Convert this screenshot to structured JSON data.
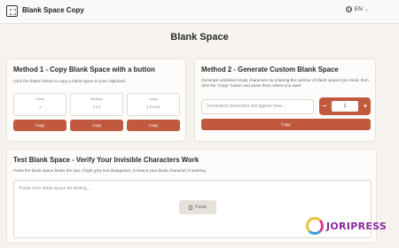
{
  "header": {
    "brand": "Blank Space Copy",
    "lang": "EN"
  },
  "page_title": "Blank Space",
  "method1": {
    "title": "Method 1 - Copy Blank Space with a button",
    "desc": "Click the button below to copy a blank space to your clipboard.",
    "options": [
      {
        "label": "Small",
        "chars": "1"
      },
      {
        "label": "Medium",
        "chars": "1 2 3"
      },
      {
        "label": "Large",
        "chars": "1 2 3 4 5"
      }
    ],
    "copy_label": "Copy"
  },
  "method2": {
    "title": "Method 2 - Generate Custom Blank Space",
    "desc": "Generate unlimited empty characters by entering the number of blank spaces you need, then click the \"Copy\" button and paste them where you want",
    "input_placeholder": "Generated characters will appear here...",
    "minus": "−",
    "plus": "+",
    "count": "1",
    "copy_label": "Copy"
  },
  "test": {
    "title": "Test Blank Space - Verify Your Invisible Characters Work",
    "desc": "Paste the blank space below the text. If light grey text disappears, it means your blank character is working.",
    "placeholder": "Paste here blank space for testing....",
    "paste_label": "Paste"
  },
  "watermark": {
    "text": "JORIPRESS"
  },
  "colors": {
    "accent": "#c1593e",
    "background": "#f6f3ef"
  }
}
